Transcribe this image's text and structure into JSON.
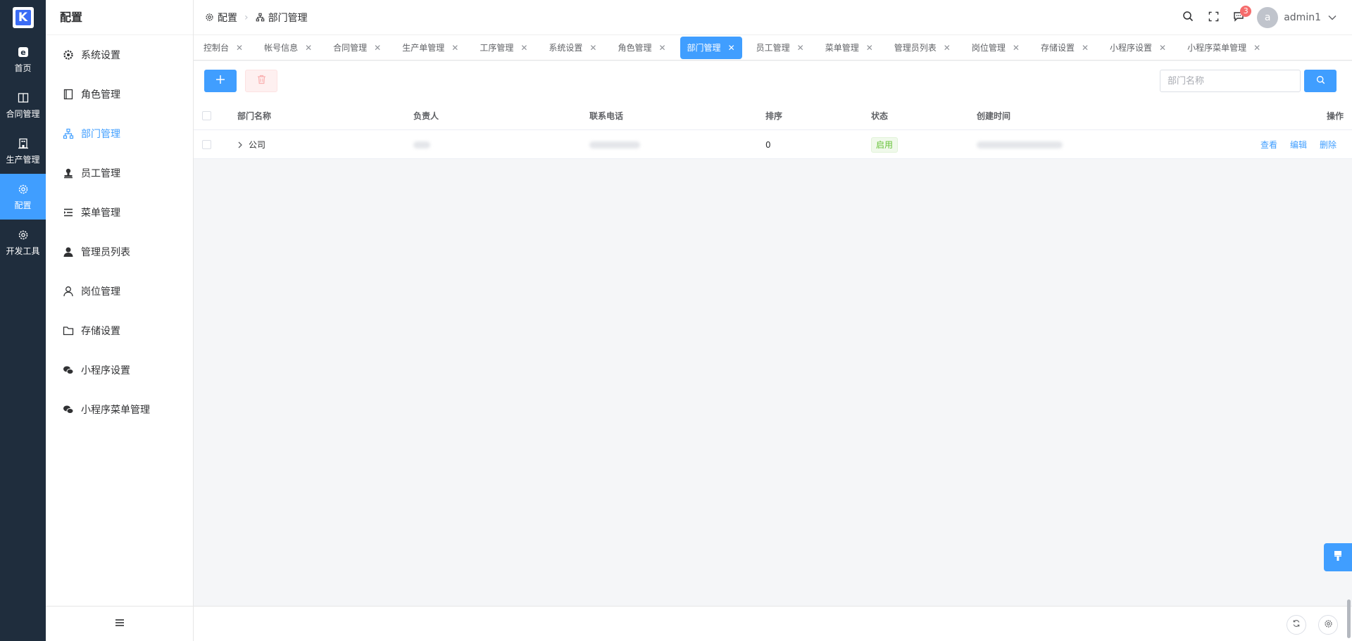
{
  "colors": {
    "rail_bg": "#1f2d3d",
    "accent": "#409eff",
    "status_enabled": "#67c23a",
    "danger": "#f56c6c"
  },
  "rail": {
    "logo_letter": "K",
    "items": [
      {
        "label": "首页",
        "icon": "home-e-icon"
      },
      {
        "label": "合同管理",
        "icon": "book-icon"
      },
      {
        "label": "生产管理",
        "icon": "building-icon"
      },
      {
        "label": "配置",
        "icon": "gear-icon"
      },
      {
        "label": "开发工具",
        "icon": "gear-icon"
      }
    ],
    "active": "配置"
  },
  "sidebar": {
    "title": "配置",
    "items": [
      {
        "label": "系统设置",
        "icon": "gear-icon"
      },
      {
        "label": "角色管理",
        "icon": "notebook-icon"
      },
      {
        "label": "部门管理",
        "icon": "org-chart-icon"
      },
      {
        "label": "员工管理",
        "icon": "stamp-icon"
      },
      {
        "label": "菜单管理",
        "icon": "menu-list-icon"
      },
      {
        "label": "管理员列表",
        "icon": "user-solid-icon"
      },
      {
        "label": "岗位管理",
        "icon": "user-outline-icon"
      },
      {
        "label": "存储设置",
        "icon": "folder-icon"
      },
      {
        "label": "小程序设置",
        "icon": "wechat-icon"
      },
      {
        "label": "小程序菜单管理",
        "icon": "wechat-icon"
      }
    ],
    "active": "部门管理",
    "collapse_icon": "hamburger-icon"
  },
  "header": {
    "breadcrumb": [
      {
        "label": "配置",
        "icon": "gear-icon"
      },
      {
        "label": "部门管理",
        "icon": "org-chart-icon"
      }
    ],
    "notification_count": "3",
    "user": {
      "avatar_letter": "a",
      "name": "admin1"
    }
  },
  "tabs": [
    "控制台",
    "帐号信息",
    "合同管理",
    "生产单管理",
    "工序管理",
    "系统设置",
    "角色管理",
    "部门管理",
    "员工管理",
    "菜单管理",
    "管理员列表",
    "岗位管理",
    "存储设置",
    "小程序设置",
    "小程序菜单管理"
  ],
  "active_tab": "部门管理",
  "toolbar": {
    "search_placeholder": "部门名称"
  },
  "table": {
    "columns": [
      "部门名称",
      "负责人",
      "联系电话",
      "排序",
      "状态",
      "创建时间",
      "操作"
    ],
    "rows": [
      {
        "name": "公司",
        "sort": "0",
        "status": "启用",
        "actions": [
          "查看",
          "编辑",
          "删除"
        ]
      }
    ]
  }
}
